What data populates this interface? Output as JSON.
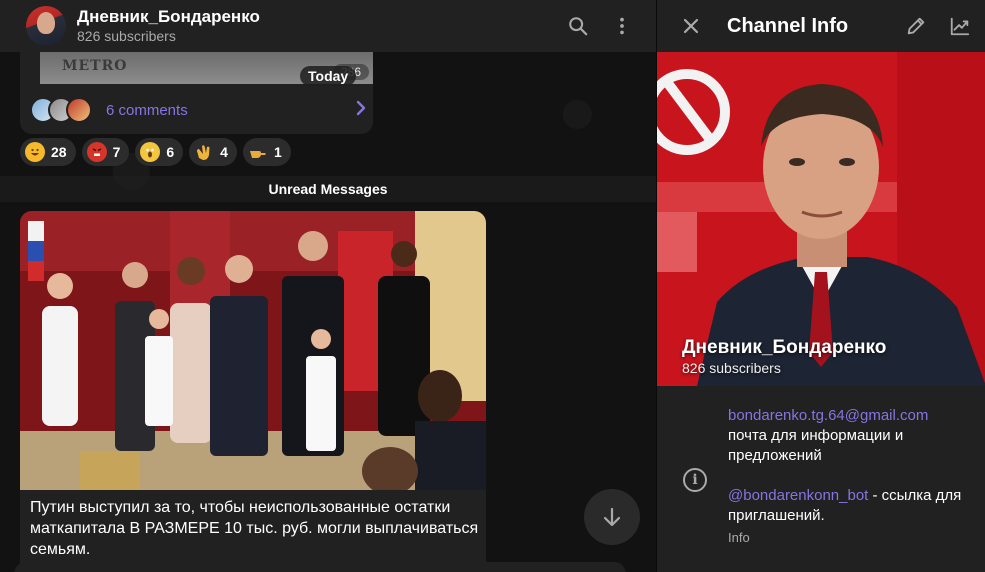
{
  "chat": {
    "title": "Дневник_Бондаренко",
    "subscribers": "826 subscribers",
    "prev_post": {
      "media_logo": "METRO",
      "time_fragment": "286",
      "comments_label": "6 comments"
    },
    "date_pill": "Today",
    "reactions": [
      {
        "icon": "rolling-laughing-emoji",
        "color": "#f5b92b",
        "count": "28"
      },
      {
        "icon": "angry-face-emoji",
        "color": "#d6352a",
        "count": "7"
      },
      {
        "icon": "screaming-face-emoji",
        "color": "#f3c640",
        "count": "6"
      },
      {
        "icon": "clapping-hands-emoji",
        "color": "#f0b43a",
        "count": "4"
      },
      {
        "icon": "pointing-hand-emoji",
        "color": "#e9a93b",
        "count": "1"
      }
    ],
    "unread_label": "Unread Messages",
    "post_text": "Путин выступил за то, чтобы неиспользованные остатки маткапитала В РАЗМЕРЕ 10 тыс. руб. могли выплачиваться семьям."
  },
  "info": {
    "title": "Channel Info",
    "name": "Дневник_Бондаренко",
    "subscribers": "826 subscribers",
    "email": "bondarenko.tg.64@gmail.com",
    "email_desc": "почта для информации и предложений",
    "bot": "@bondarenkonn_bot",
    "bot_desc": " - ссылка для приглашений.",
    "field_label": "Info"
  },
  "colors": {
    "accent": "#8774e1",
    "panel": "#212121",
    "background": "#0f0f0f",
    "muted_text": "#aaaaaa"
  }
}
